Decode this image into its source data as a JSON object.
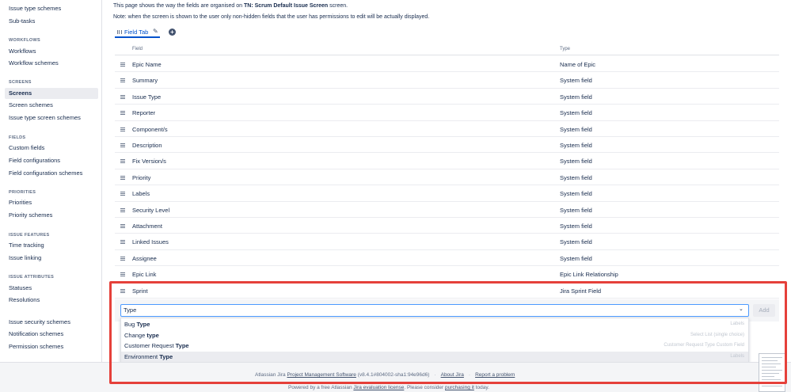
{
  "sidebar": {
    "top_items": [
      {
        "label": "Issue type schemes"
      },
      {
        "label": "Sub-tasks"
      }
    ],
    "sections": [
      {
        "heading": "WORKFLOWS",
        "items": [
          {
            "label": "Workflows"
          },
          {
            "label": "Workflow schemes"
          }
        ]
      },
      {
        "heading": "SCREENS",
        "items": [
          {
            "label": "Screens",
            "active": true
          },
          {
            "label": "Screen schemes"
          },
          {
            "label": "Issue type screen schemes"
          }
        ]
      },
      {
        "heading": "FIELDS",
        "items": [
          {
            "label": "Custom fields"
          },
          {
            "label": "Field configurations"
          },
          {
            "label": "Field configuration schemes"
          }
        ]
      },
      {
        "heading": "PRIORITIES",
        "items": [
          {
            "label": "Priorities"
          },
          {
            "label": "Priority schemes"
          }
        ]
      },
      {
        "heading": "ISSUE FEATURES",
        "items": [
          {
            "label": "Time tracking"
          },
          {
            "label": "Issue linking"
          }
        ]
      },
      {
        "heading": "ISSUE ATTRIBUTES",
        "items": [
          {
            "label": "Statuses"
          },
          {
            "label": "Resolutions"
          }
        ]
      }
    ],
    "bottom_items": [
      {
        "label": "Issue security schemes"
      },
      {
        "label": "Notification schemes"
      },
      {
        "label": "Permission schemes"
      }
    ]
  },
  "intro": {
    "line1_prefix": "This page shows the way the fields are organised on ",
    "line1_bold": "TN: Scrum Default Issue Screen",
    "line1_suffix": " screen.",
    "line2": "Note: when the screen is shown to the user only non-hidden fields that the user has permissions to edit will be actually displayed."
  },
  "tab": {
    "label": "Field Tab",
    "add_label": "+"
  },
  "table": {
    "headers": {
      "field": "Field",
      "type": "Type"
    },
    "rows": [
      {
        "field": "Epic Name",
        "type": "Name of Epic"
      },
      {
        "field": "Summary",
        "type": "System field"
      },
      {
        "field": "Issue Type",
        "type": "System field"
      },
      {
        "field": "Reporter",
        "type": "System field"
      },
      {
        "field": "Component/s",
        "type": "System field"
      },
      {
        "field": "Description",
        "type": "System field"
      },
      {
        "field": "Fix Version/s",
        "type": "System field"
      },
      {
        "field": "Priority",
        "type": "System field"
      },
      {
        "field": "Labels",
        "type": "System field"
      },
      {
        "field": "Security Level",
        "type": "System field"
      },
      {
        "field": "Attachment",
        "type": "System field"
      },
      {
        "field": "Linked Issues",
        "type": "System field"
      },
      {
        "field": "Assignee",
        "type": "System field"
      },
      {
        "field": "Epic Link",
        "type": "Epic Link Relationship"
      },
      {
        "field": "Sprint",
        "type": "Jira Sprint Field"
      }
    ]
  },
  "add_field": {
    "value": "Type",
    "button": "Add",
    "suggestions": [
      {
        "prefix": "Bug ",
        "match": "Type",
        "type": "Labels"
      },
      {
        "prefix": "Change ",
        "match": "type",
        "type": "Select List (single choice)"
      },
      {
        "prefix": "Customer Request ",
        "match": "Type",
        "type": "Customer Request Type Custom Field"
      },
      {
        "prefix": "Environment ",
        "match": "Type",
        "type": "Labels",
        "highlighted": true
      }
    ]
  },
  "footer": {
    "line1_prefix": "Atlassian Jira ",
    "line1_link": "Project Management Software",
    "line1_version": " (v8.4.1#804002-sha1:94e96d6)",
    "about": "About Jira",
    "report": "Report a problem",
    "line2_prefix": "Powered by a free Atlassian ",
    "line2_link": "Jira evaluation license",
    "line2_middle": ". Please consider ",
    "line2_link2": "purchasing it",
    "line2_suffix": " today."
  },
  "colors": {
    "highlight": "#e5403a",
    "link": "#0052cc"
  }
}
